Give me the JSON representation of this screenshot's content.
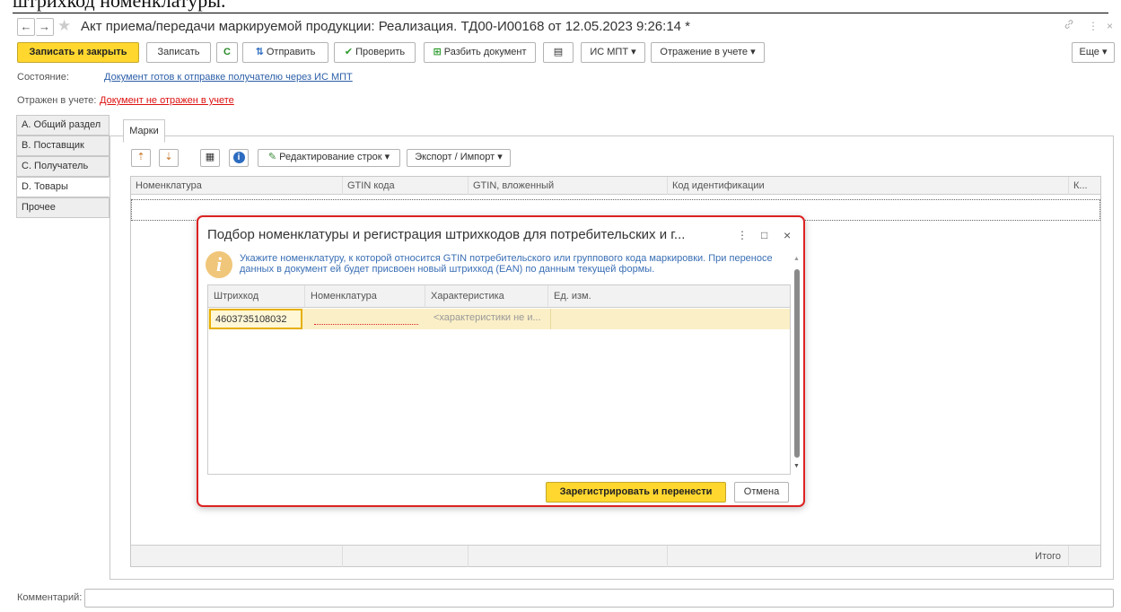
{
  "caption": "штрихкод номенклатуры.",
  "window": {
    "title": "Акт приема/передачи маркируемой продукции: Реализация.  ТД00-И00168 от 12.05.2023 9:26:14 *",
    "nav_back": "←",
    "nav_forward": "→",
    "star": "★",
    "link_glyph": "🔗",
    "menu_glyph": "⋮",
    "close_glyph": "×"
  },
  "toolbar": {
    "save_close": "Записать и закрыть",
    "save": "Записать",
    "refresh": "C",
    "send": "Отправить",
    "check": "Проверить",
    "split": "Разбить документ",
    "print_icon": "▤",
    "is_mpt": "ИС МПТ",
    "reflect": "Отражение в учете",
    "more": "Еще"
  },
  "status": {
    "state_label": "Состояние:",
    "state_value": "Документ готов к отправке получателю через ИС МПТ",
    "acc_label": "Отражен в учете:",
    "acc_value": "Документ не отражен в учете"
  },
  "side_tabs": [
    "A. Общий раздел",
    "B. Поставщик",
    "C. Получатель",
    "D. Товары",
    "Прочее"
  ],
  "marks_tab": "Марки",
  "inner_toolbar": {
    "edit_rows": "Редактирование строк",
    "export_import": "Экспорт / Импорт"
  },
  "grid": {
    "columns": [
      "Номенклатура",
      "GTIN кода",
      "GTIN, вложенный",
      "Код идентификации",
      "К..."
    ],
    "total_label": "Итого"
  },
  "comment_label": "Комментарий:",
  "dialog": {
    "title": "Подбор номенклатуры и регистрация штрихкодов для потребительских и г...",
    "hint": "Укажите номенклатуру, к которой относится GTIN потребительского или группового кода маркировки. При переносе данных в документ ей будет присвоен новый штрихкод (EAN) по данным текущей формы.",
    "columns": [
      "Штрихкод",
      "Номенклатура",
      "Характеристика",
      "Ед. изм."
    ],
    "row": {
      "barcode": "4603735108032",
      "nomenclature": "",
      "characteristic": "<характеристики не и...",
      "unit": ""
    },
    "ok": "Зарегистрировать и перенести",
    "cancel": "Отмена",
    "maximize_glyph": "□"
  }
}
